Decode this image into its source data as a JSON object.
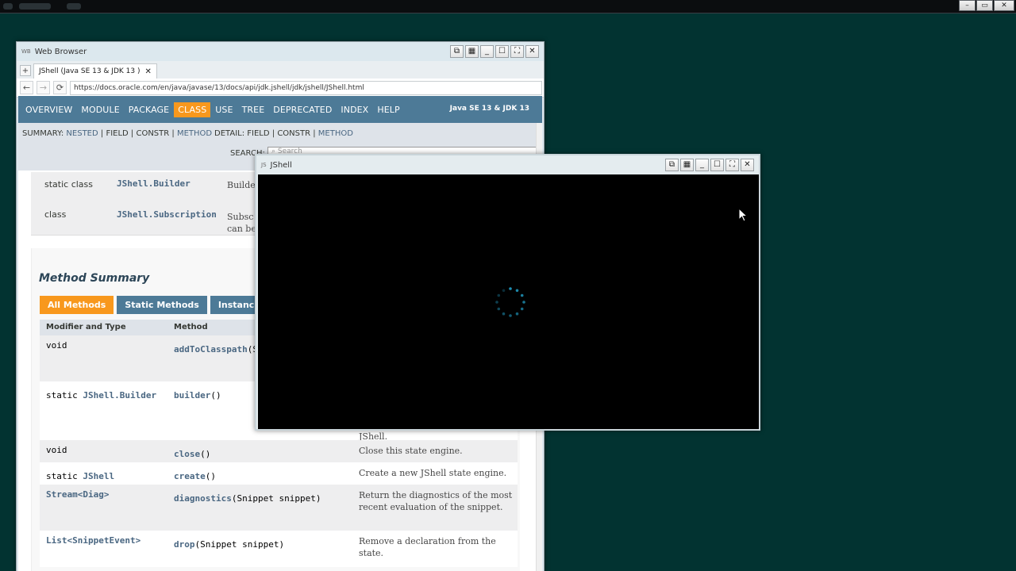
{
  "desktop": {
    "controls": [
      "–",
      "▭",
      "✕"
    ]
  },
  "browser": {
    "app_icon": "WB",
    "title": "Web Browser",
    "window_buttons": [
      "⧉",
      "▦",
      "_",
      "☐",
      "⛶",
      "✕"
    ],
    "new_tab": "+",
    "tab_title": "JShell (Java SE 13 & JDK 13 )",
    "tab_close": "✕",
    "url": "https://docs.oracle.com/en/java/javase/13/docs/api/jdk.jshell/jdk/jshell/JShell.html",
    "nav": {
      "back": "←",
      "forward": "→",
      "reload": "⟳"
    }
  },
  "javadoc": {
    "topnav": [
      "OVERVIEW",
      "MODULE",
      "PACKAGE",
      "CLASS",
      "USE",
      "TREE",
      "DEPRECATED",
      "INDEX",
      "HELP"
    ],
    "active_nav": "CLASS",
    "brand": "Java SE 13 & JDK 13",
    "summary_label": "SUMMARY:",
    "summary_links": [
      "NESTED",
      "FIELD",
      "CONSTR",
      "METHOD"
    ],
    "detail_label": "DETAIL:",
    "detail_links": [
      "FIELD",
      "CONSTR",
      "METHOD"
    ],
    "search_label": "SEARCH:",
    "search_placeholder": "Search",
    "nested_rows": [
      {
        "modifier": "static class",
        "type": "JShell.Builder",
        "desc": "Builde"
      },
      {
        "modifier": "class",
        "type": "JShell.Subscription",
        "desc": "Subsc can be"
      }
    ],
    "method_summary_title": "Method Summary",
    "method_tabs": [
      "All Methods",
      "Static Methods",
      "Instanc"
    ],
    "method_header": {
      "modifier": "Modifier and Type",
      "method": "Method"
    },
    "methods": [
      {
        "mod": "void",
        "mod_link": "",
        "name": "addToClasspath",
        "args": "(S",
        "desc": ""
      },
      {
        "mod": "static ",
        "mod_link": "JShell.Builder",
        "name": "builder",
        "args": "()",
        "desc": "JShell."
      },
      {
        "mod": "void",
        "mod_link": "",
        "name": "close",
        "args": "()",
        "desc": "Close this state engine."
      },
      {
        "mod": "static ",
        "mod_link": "JShell",
        "name": "create",
        "args": "()",
        "desc": "Create a new JShell state engine."
      },
      {
        "mod": "",
        "mod_link": "Stream<Diag>",
        "name": "diagnostics",
        "args": "(Snippet snippet)",
        "desc": "Return the diagnostics of the most recent evaluation of the snippet."
      },
      {
        "mod": "",
        "mod_link": "List<SnippetEvent>",
        "name": "drop",
        "args": "(Snippet snippet)",
        "desc": "Remove a declaration from the state."
      }
    ]
  },
  "jshell": {
    "app_icon": "JS",
    "title": "JShell",
    "window_buttons": [
      "⧉",
      "▦",
      "_",
      "☐",
      "⛶",
      "✕"
    ],
    "spinner_color": "#1f8fb3"
  }
}
